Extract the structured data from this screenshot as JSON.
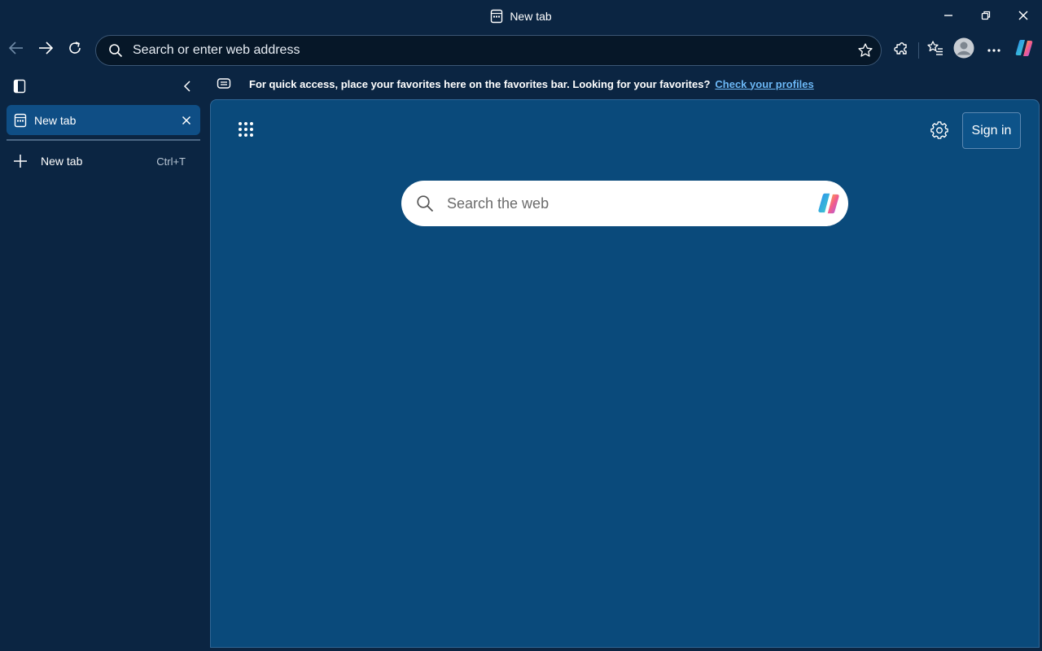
{
  "window": {
    "title": "New tab"
  },
  "toolbar": {
    "address_placeholder": "Search or enter web address"
  },
  "sidebar": {
    "tabs": [
      {
        "label": "New tab"
      }
    ],
    "new_tab": {
      "label": "New tab",
      "shortcut": "Ctrl+T"
    }
  },
  "favorites_bar": {
    "message": "For quick access, place your favorites here on the favorites bar. Looking for your favorites?",
    "link": "Check your profiles"
  },
  "new_tab_page": {
    "sign_in": "Sign in",
    "search_placeholder": "Search the web"
  },
  "icons": {
    "title": "tab-page-icon",
    "minimize": "minimize-icon",
    "restore": "restore-icon",
    "close": "close-icon",
    "back": "arrow-left-icon",
    "forward": "arrow-right-icon",
    "refresh": "refresh-icon",
    "address_search": "search-icon",
    "favorite_star": "star-icon",
    "extensions": "puzzle-icon",
    "favorites": "favorites-list-icon",
    "profile": "avatar-icon",
    "more": "ellipsis-icon",
    "copilot": "copilot-icon",
    "vertical_tabs": "vertical-tabs-icon",
    "collapse": "chevron-left-icon",
    "tab_close": "close-icon",
    "new_tab": "plus-icon",
    "favorites_bar": "favorites-bar-icon",
    "apps": "app-launcher-icon",
    "settings": "gear-icon",
    "web_search": "search-icon"
  },
  "colors": {
    "frame": "#0b2542",
    "content": "#0a4a7b",
    "active_tab": "#0f4e85",
    "link": "#6cb8f6"
  }
}
